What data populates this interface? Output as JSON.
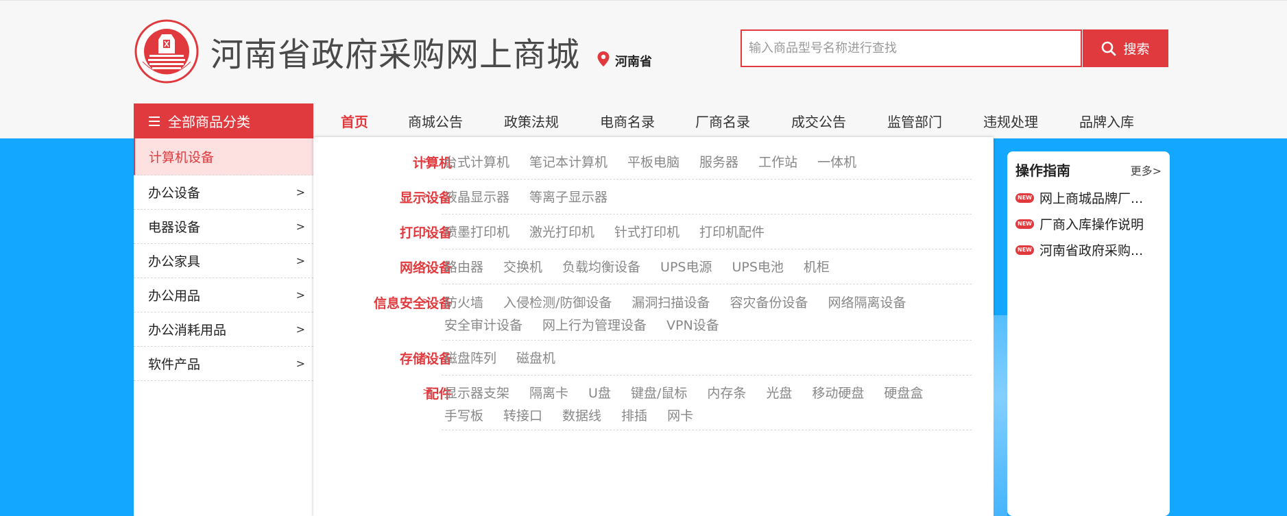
{
  "header": {
    "site_title": "河南省政府采购网上商城",
    "location": "河南省",
    "search_placeholder": "输入商品型号名称进行查找",
    "search_button": "搜索"
  },
  "nav": {
    "category_header": "全部商品分类",
    "tabs": [
      "首页",
      "商城公告",
      "政策法规",
      "电商名录",
      "厂商名录",
      "成交公告",
      "监管部门",
      "违规处理",
      "品牌入库"
    ],
    "active_tab": "首页"
  },
  "categories": [
    {
      "label": "计算机设备",
      "active": true
    },
    {
      "label": "办公设备"
    },
    {
      "label": "电器设备"
    },
    {
      "label": "办公家具"
    },
    {
      "label": "办公用品"
    },
    {
      "label": "办公消耗用品"
    },
    {
      "label": "软件产品"
    }
  ],
  "category_arrow": ">",
  "dropdown": {
    "chevron": ">",
    "groups": [
      {
        "label": "计算机",
        "items": [
          "台式计算机",
          "笔记本计算机",
          "平板电脑",
          "服务器",
          "工作站",
          "一体机"
        ]
      },
      {
        "label": "显示设备",
        "items": [
          "液晶显示器",
          "等离子显示器"
        ]
      },
      {
        "label": "打印设备",
        "items": [
          "喷墨打印机",
          "激光打印机",
          "针式打印机",
          "打印机配件"
        ]
      },
      {
        "label": "网络设备",
        "items": [
          "路由器",
          "交换机",
          "负载均衡设备",
          "UPS电源",
          "UPS电池",
          "机柜"
        ]
      },
      {
        "label": "信息安全设备",
        "items": [
          "防火墙",
          "入侵检测/防御设备",
          "漏洞扫描设备",
          "容灾备份设备",
          "网络隔离设备",
          "安全审计设备",
          "网上行为管理设备",
          "VPN设备"
        ]
      },
      {
        "label": "存储设备",
        "items": [
          "磁盘阵列",
          "磁盘机"
        ]
      },
      {
        "label": "配件",
        "items": [
          "显示器支架",
          "隔离卡",
          "U盘",
          "键盘/鼠标",
          "内存条",
          "光盘",
          "移动硬盘",
          "硬盘盒",
          "手写板",
          "转接口",
          "数据线",
          "排插",
          "网卡"
        ]
      }
    ]
  },
  "guide": {
    "title": "操作指南",
    "more": "更多>",
    "badge": "NEW",
    "items": [
      "网上商城品牌厂...",
      "厂商入库操作说明",
      "河南省政府采购..."
    ]
  },
  "colors": {
    "accent": "#e03a3e",
    "background": "#13a7ff"
  }
}
